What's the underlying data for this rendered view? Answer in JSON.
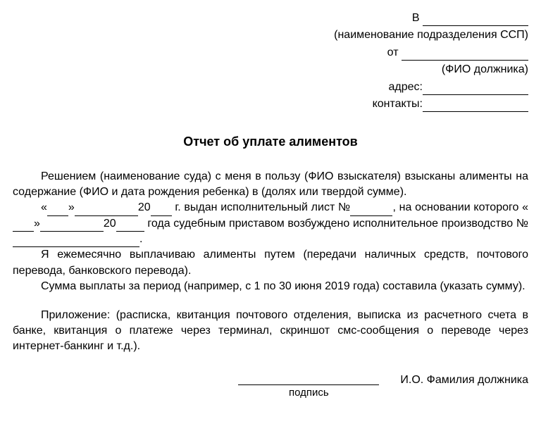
{
  "header": {
    "to_prefix": "В",
    "to_caption": "(наименование подразделения ССП)",
    "from_prefix": "от",
    "from_caption": "(ФИО должника)",
    "address_label": "адрес:",
    "contacts_label": "контакты:"
  },
  "title": "Отчет об уплате алиментов",
  "body": {
    "p1": "Решением (наименование суда) с меня в пользу (ФИО взыскателя) взысканы алименты на содержание (ФИО и дата рождения ребенка) в (долях или твердой сумме).",
    "p2_prefix": "«",
    "p2_mid1": "»",
    "p2_year_prefix": "20",
    "p2_after_year1": " г. выдан исполнительный лист №",
    "p2_after_num": ", на основании которого «",
    "p2_mid2": "»",
    "p2_year_prefix2": "20",
    "p2_after_year2": " года судебным приставом возбуждено исполнительное производство №",
    "p2_end": ".",
    "p3": "Я ежемесячно выплачиваю алименты путем (передачи наличных средств, почтового перевода, банковского перевода).",
    "p4": "Сумма выплаты за период (например, с 1 по 30 июня 2019 года) составила (указать сумму).",
    "p5": "Приложение: (расписка, квитанция почтового отделения, выписка из расчетного счета в банке, квитанция о платеже через терминал, скриншот смс-сообщения о переводе через интернет-банкинг и т.д.)."
  },
  "signature": {
    "label": "подпись",
    "name": "И.О. Фамилия должника"
  }
}
